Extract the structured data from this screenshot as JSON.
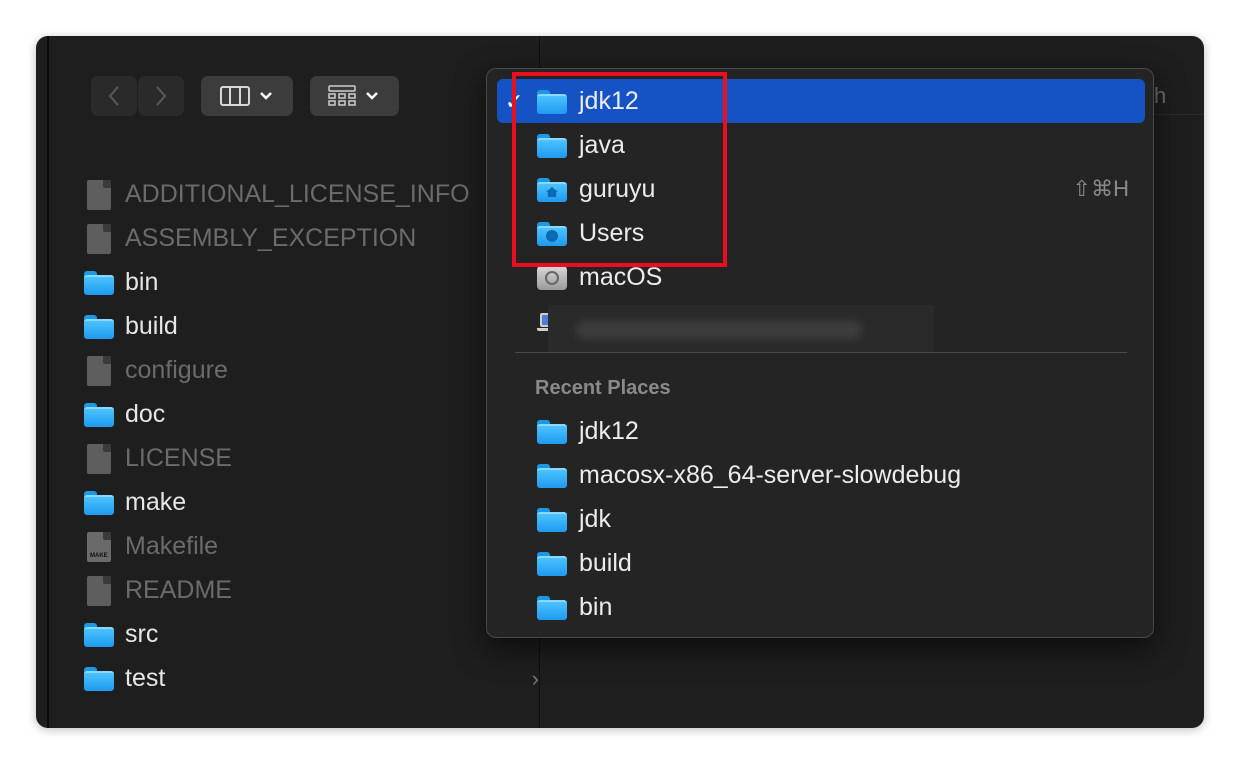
{
  "toolbar": {
    "back_icon": "chevron-left-icon",
    "forward_icon": "chevron-right-icon",
    "view_icon": "column-view-icon",
    "group_icon": "group-grid-icon",
    "search_partial": "h"
  },
  "files": [
    {
      "name": "ADDITIONAL_LICENSE_INFO",
      "kind": "document"
    },
    {
      "name": "ASSEMBLY_EXCEPTION",
      "kind": "document"
    },
    {
      "name": "bin",
      "kind": "folder"
    },
    {
      "name": "build",
      "kind": "folder"
    },
    {
      "name": "configure",
      "kind": "document"
    },
    {
      "name": "doc",
      "kind": "folder"
    },
    {
      "name": "LICENSE",
      "kind": "document"
    },
    {
      "name": "make",
      "kind": "folder"
    },
    {
      "name": "Makefile",
      "kind": "makefile"
    },
    {
      "name": "README",
      "kind": "document"
    },
    {
      "name": "src",
      "kind": "folder"
    },
    {
      "name": "test",
      "kind": "folder"
    }
  ],
  "popup": {
    "path_items": [
      {
        "label": "jdk12",
        "icon": "folder-icon",
        "selected": true,
        "check": "✓"
      },
      {
        "label": "java",
        "icon": "folder-icon"
      },
      {
        "label": "guruyu",
        "icon": "home-folder-icon",
        "shortcut": "⇧⌘H"
      },
      {
        "label": "Users",
        "icon": "users-folder-icon"
      },
      {
        "label": "macOS",
        "icon": "hard-disk-icon"
      },
      {
        "label": "",
        "icon": "laptop-icon"
      }
    ],
    "recent_header": "Recent Places",
    "recent_items": [
      {
        "label": "jdk12"
      },
      {
        "label": "macosx-x86_64-server-slowdebug"
      },
      {
        "label": "jdk"
      },
      {
        "label": "build"
      },
      {
        "label": "bin"
      }
    ]
  },
  "colors": {
    "selection": "#1552c4",
    "annotation": "#e8101e",
    "folder": "#34b0fb"
  }
}
